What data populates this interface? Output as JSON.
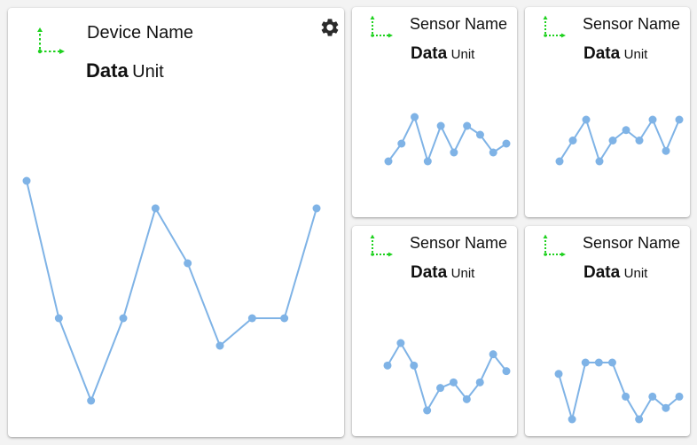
{
  "colors": {
    "accent_green": "#1fd11f",
    "series_blue": "#7fb3e6",
    "gear": "#2b2b2b"
  },
  "device": {
    "title": "Device Name",
    "value": "Data",
    "unit": "Unit",
    "icon": "axis-chart-icon",
    "settings_icon": "gear-icon",
    "chart_data": {
      "type": "line",
      "x": [
        0,
        1,
        2,
        3,
        4,
        5,
        6,
        7,
        8,
        9
      ],
      "values": [
        8,
        3,
        0,
        3,
        7,
        5,
        2,
        3,
        3,
        7
      ],
      "ylim": [
        0,
        8
      ]
    }
  },
  "sensors": [
    {
      "title": "Sensor Name",
      "value": "Data",
      "unit": "Unit",
      "icon": "axis-chart-icon",
      "chart_data": {
        "type": "line",
        "x": [
          0,
          1,
          2,
          3,
          4,
          5,
          6,
          7,
          8,
          9
        ],
        "values": [
          1,
          3,
          6,
          1,
          5,
          2,
          5,
          4,
          2,
          3
        ],
        "ylim": [
          1,
          6
        ]
      }
    },
    {
      "title": "Sensor Name",
      "value": "Data",
      "unit": "Unit",
      "icon": "axis-chart-icon",
      "chart_data": {
        "type": "line",
        "x": [
          0,
          1,
          2,
          3,
          4,
          5,
          6,
          7,
          8,
          9
        ],
        "values": [
          1,
          3,
          5,
          1,
          3,
          4,
          3,
          5,
          2,
          5
        ],
        "ylim": [
          1,
          5
        ]
      }
    },
    {
      "title": "Sensor Name",
      "value": "Data",
      "unit": "Unit",
      "icon": "axis-chart-icon",
      "chart_data": {
        "type": "line",
        "x": [
          0,
          1,
          2,
          3,
          4,
          5,
          6,
          7,
          8,
          9
        ],
        "values": [
          5,
          7,
          5,
          1,
          3,
          3.5,
          2,
          3.5,
          6,
          4.5
        ],
        "ylim": [
          1,
          7
        ]
      }
    },
    {
      "title": "Sensor Name",
      "value": "Data",
      "unit": "Unit",
      "icon": "axis-chart-icon",
      "chart_data": {
        "type": "line",
        "x": [
          0,
          1,
          2,
          3,
          4,
          5,
          6,
          7,
          8,
          9
        ],
        "values": [
          5,
          1,
          6,
          6,
          6,
          3,
          1,
          3,
          2,
          3
        ],
        "ylim": [
          1,
          6
        ]
      }
    }
  ]
}
